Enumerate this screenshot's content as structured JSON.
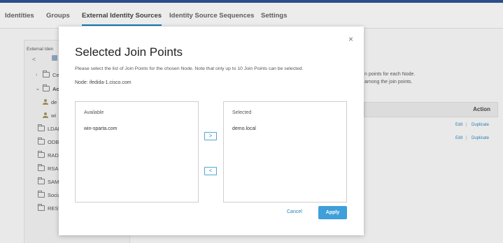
{
  "nav": {
    "tabs": [
      {
        "label": "Identities"
      },
      {
        "label": "Groups"
      },
      {
        "label": "External Identity Sources"
      },
      {
        "label": "Identity Source Sequences"
      },
      {
        "label": "Settings"
      }
    ],
    "active_tab": "External Identity Sources"
  },
  "sidebar": {
    "title": "External Iden",
    "items": [
      {
        "label": "Ce"
      },
      {
        "label": "Ac"
      },
      {
        "label": "de"
      },
      {
        "label": "wi"
      },
      {
        "label": "LDAP"
      },
      {
        "label": "ODBC"
      },
      {
        "label": "RADI"
      },
      {
        "label": "RSA"
      },
      {
        "label": "SAM"
      },
      {
        "label": "Socia"
      },
      {
        "label": "REST"
      }
    ]
  },
  "background": {
    "line1": "n points for each Node.",
    "line2": "among the join points.",
    "table_action_header": "Action",
    "rows": [
      {
        "edit": "Edit",
        "sep": "|",
        "duplicate": "Duplicate"
      },
      {
        "edit": "Edit",
        "sep": "|",
        "duplicate": "Duplicate"
      }
    ]
  },
  "modal": {
    "title": "Selected Join Points",
    "description": "Please select the list of Join Points for the chosen Node. Note that only up to 10 Join Points can be selected.",
    "node_label": "Node:",
    "node_value": "ifedida-1.cisco.com",
    "available": {
      "header": "Available",
      "items": [
        "win-sparta.com"
      ]
    },
    "selected": {
      "header": "Selected",
      "items": [
        "demo.local"
      ]
    },
    "move_right": ">",
    "move_left": "<",
    "close": "×",
    "cancel_label": "Cancel",
    "apply_label": "Apply"
  },
  "colors": {
    "accent": "#3f9fda",
    "link": "#2a7fb4",
    "active_tab_underline": "#0d7aaf"
  }
}
